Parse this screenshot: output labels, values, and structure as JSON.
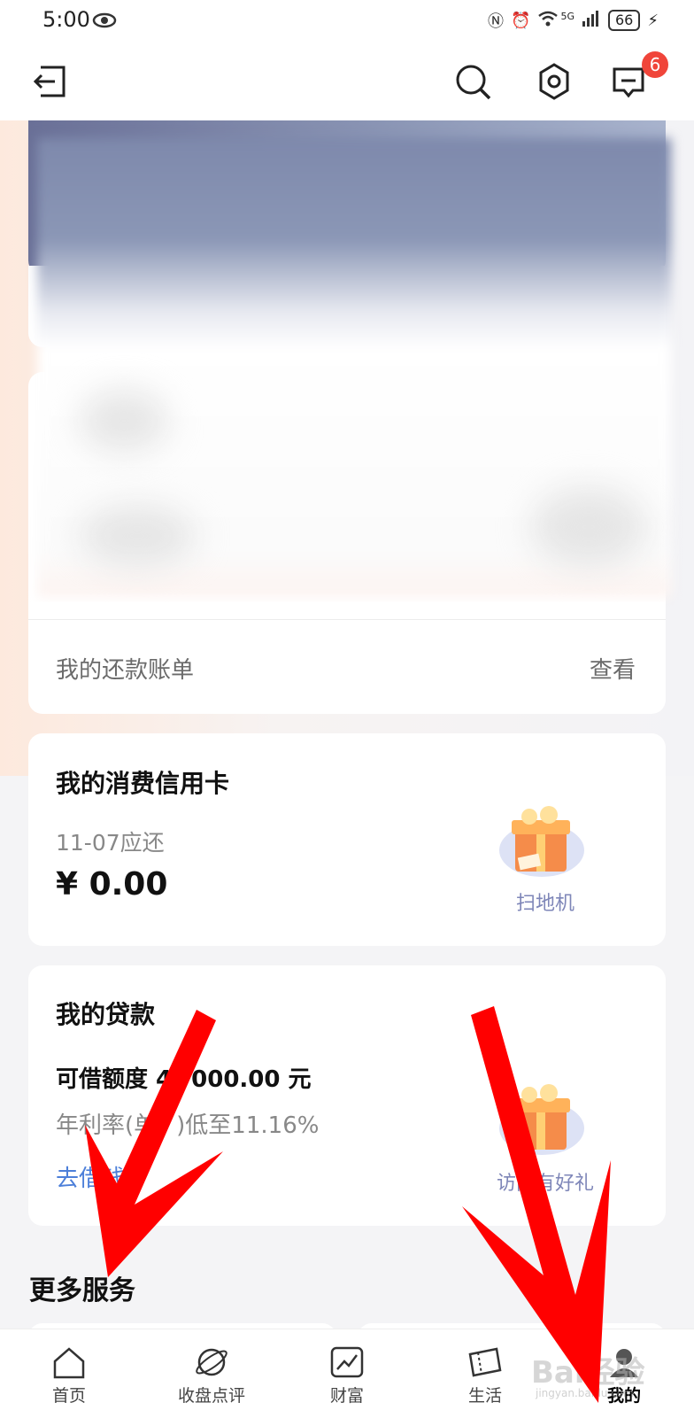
{
  "status_bar": {
    "time": "5:00",
    "network": "5G",
    "battery": "66"
  },
  "top_nav": {
    "notification_count": "6"
  },
  "bill": {
    "label": "我的还款账单",
    "action": "查看"
  },
  "credit_card": {
    "title": "我的消费信用卡",
    "due_date": "11-07应还",
    "amount": "¥ 0.00",
    "promo_label": "扫地机"
  },
  "loan": {
    "title": "我的贷款",
    "limit_prefix": "可借额度 4",
    "limit_suffix": "000.00 元",
    "rate_prefix": "年利率(单",
    "rate_suffix": ")低至11.16%",
    "action": "去借钱",
    "promo_label": "访问有好礼"
  },
  "more_services": {
    "title": "更多服务"
  },
  "tabs": [
    {
      "label": "首页",
      "icon": "home-icon"
    },
    {
      "label": "收盘点评",
      "icon": "planet-icon"
    },
    {
      "label": "财富",
      "icon": "trend-chart-icon"
    },
    {
      "label": "生活",
      "icon": "ticket-icon"
    },
    {
      "label": "我的",
      "icon": "user-icon",
      "active": true
    }
  ],
  "watermark": {
    "text": "Bai经验",
    "sub": "jingyan.baidu.com"
  },
  "colors": {
    "badge": "#f0453a",
    "link": "#4c7fd9",
    "annotation_arrow": "#ff0000"
  }
}
